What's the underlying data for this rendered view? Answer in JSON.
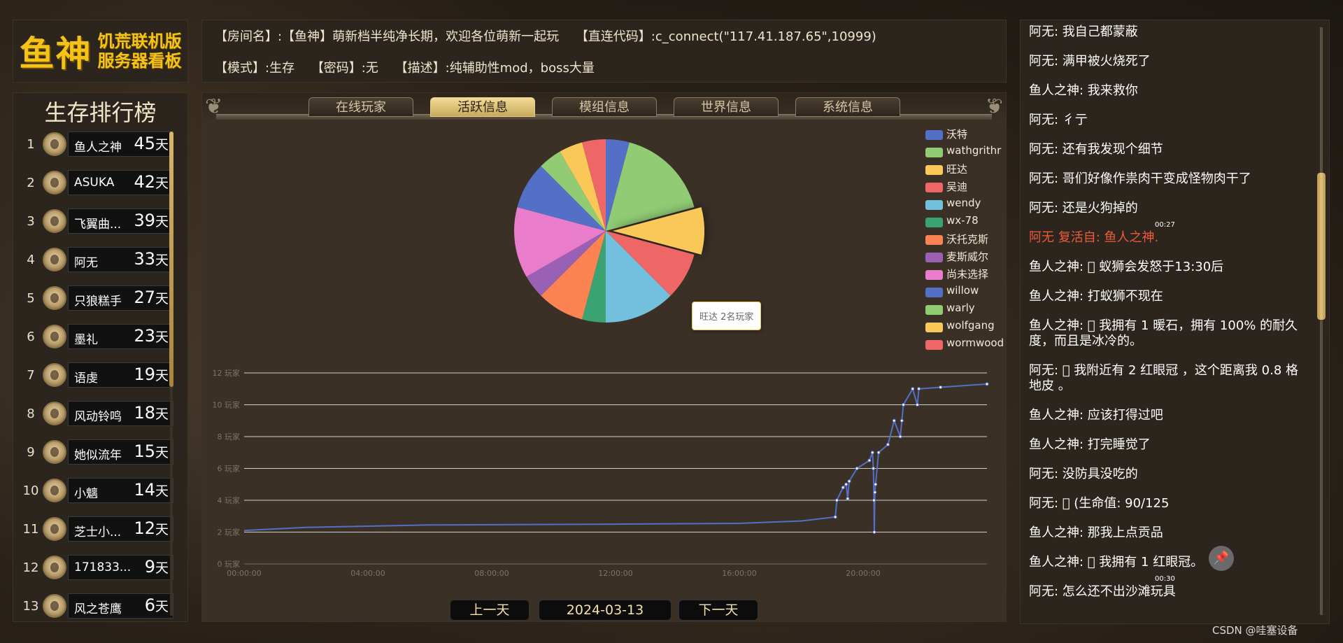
{
  "logo": {
    "big": "鱼神",
    "line1": "饥荒联机版",
    "line2": "服务器看板"
  },
  "ranking": {
    "title": "生存排行榜",
    "day_unit": "天",
    "items": [
      {
        "rank": "1",
        "name": "鱼人之神",
        "days": "45"
      },
      {
        "rank": "2",
        "name": "ASUKA",
        "days": "42"
      },
      {
        "rank": "3",
        "name": "飞翼曲...",
        "days": "39"
      },
      {
        "rank": "4",
        "name": "阿无",
        "days": "33"
      },
      {
        "rank": "5",
        "name": "只狼糕手",
        "days": "27"
      },
      {
        "rank": "6",
        "name": "墨礼",
        "days": "23"
      },
      {
        "rank": "7",
        "name": "语虔",
        "days": "19"
      },
      {
        "rank": "8",
        "name": "风动铃鸣",
        "days": "18"
      },
      {
        "rank": "9",
        "name": "她似流年",
        "days": "15"
      },
      {
        "rank": "10",
        "name": "小魑",
        "days": "14"
      },
      {
        "rank": "11",
        "name": "芝士小...",
        "days": "12"
      },
      {
        "rank": "12",
        "name": "171833...",
        "days": "9"
      },
      {
        "rank": "13",
        "name": "风之苍鹰",
        "days": "6"
      }
    ]
  },
  "info": {
    "room_label": "【房间名】:",
    "room_value": "【鱼神】萌新档半纯净长期，欢迎各位萌新一起玩",
    "connect_label": "【直连代码】:",
    "connect_value": "c_connect(\"117.41.187.65\",10999)",
    "mode_label": "【模式】:",
    "mode_value": "生存",
    "password_label": "【密码】:",
    "password_value": "无",
    "desc_label": "【描述】:",
    "desc_value": "纯辅助性mod，boss大量"
  },
  "tabs": [
    {
      "label": "在线玩家",
      "active": false
    },
    {
      "label": "活跃信息",
      "active": true
    },
    {
      "label": "模组信息",
      "active": false
    },
    {
      "label": "世界信息",
      "active": false
    },
    {
      "label": "系统信息",
      "active": false
    }
  ],
  "tooltip": "旺达 2名玩家",
  "date_nav": {
    "prev": "上一天",
    "date": "2024-03-13",
    "next": "下一天"
  },
  "chart_data": [
    {
      "type": "pie",
      "legend_position": "right",
      "categories": [
        "沃特",
        "wathgrithr",
        "旺达",
        "吴迪",
        "wendy",
        "wx-78",
        "沃托克斯",
        "麦斯威尔",
        "尚未选择",
        "willow",
        "warly",
        "wolfgang",
        "wormwood"
      ],
      "values": [
        1,
        4,
        2,
        2,
        3,
        1,
        2,
        1,
        3,
        2,
        1,
        1,
        1
      ],
      "colors": [
        "#5470c6",
        "#91cc75",
        "#fac858",
        "#ee6666",
        "#73c0de",
        "#3ba272",
        "#fc8452",
        "#9a60b4",
        "#ea7ccc",
        "#5470c6",
        "#91cc75",
        "#fac858",
        "#ee6666"
      ]
    },
    {
      "type": "line",
      "y_unit": "玩家",
      "ylim": [
        0,
        12
      ],
      "y_ticks": [
        "0 玩家",
        "2 玩家",
        "4 玩家",
        "6 玩家",
        "8 玩家",
        "10 玩家",
        "12 玩家"
      ],
      "x_ticks": [
        "00:00:00",
        "04:00:00",
        "08:00:00",
        "12:00:00",
        "16:00:00",
        "20:00:00"
      ],
      "x_range_hours": [
        0,
        24
      ],
      "color": "#5470c6",
      "points": [
        [
          0,
          2.1
        ],
        [
          2,
          2.3
        ],
        [
          6,
          2.45
        ],
        [
          12,
          2.5
        ],
        [
          16,
          2.55
        ],
        [
          18,
          2.7
        ],
        [
          19.1,
          2.95
        ],
        [
          19.15,
          4.0
        ],
        [
          19.35,
          4.8
        ],
        [
          19.45,
          5.0
        ],
        [
          19.5,
          4.1
        ],
        [
          19.55,
          5.2
        ],
        [
          19.8,
          6.0
        ],
        [
          20.2,
          6.5
        ],
        [
          20.3,
          7.0
        ],
        [
          20.33,
          6.0
        ],
        [
          20.35,
          4.0
        ],
        [
          20.36,
          2.0
        ],
        [
          20.38,
          4.5
        ],
        [
          20.4,
          5.0
        ],
        [
          20.5,
          7.0
        ],
        [
          20.8,
          7.5
        ],
        [
          21.0,
          9.0
        ],
        [
          21.2,
          8.0
        ],
        [
          21.25,
          9.0
        ],
        [
          21.3,
          10.0
        ],
        [
          21.6,
          11.0
        ],
        [
          21.75,
          10.0
        ],
        [
          21.8,
          11.0
        ],
        [
          22.5,
          11.1
        ],
        [
          24,
          11.3
        ]
      ]
    }
  ],
  "chat": [
    {
      "text": "阿无: 我自己都蒙蔽"
    },
    {
      "text": "阿无: 满甲被火烧死了"
    },
    {
      "text": "鱼人之神: 我来救你"
    },
    {
      "text": "阿无: 彳亍"
    },
    {
      "text": "阿无: 还有我发现个细节"
    },
    {
      "text": "阿无: 哥们好像作祟肉干变成怪物肉干了"
    },
    {
      "text": "阿无: 还是火狗掉的"
    },
    {
      "text": "阿无 复活自:   鱼人之神.",
      "system": true,
      "time": "00:27"
    },
    {
      "text": "鱼人之神: 󰀀 蚁狮会发怒于13:30后"
    },
    {
      "text": "鱼人之神: 打蚁狮不现在"
    },
    {
      "text": "鱼人之神: 󰀀 我拥有 1 暖石，拥有 100% 的耐久度，而且是冰冷的。"
    },
    {
      "text": "阿无: 󰀀 我附近有 2 红眼冠 ，这个距离我 0.8 格地皮 。"
    },
    {
      "text": "鱼人之神: 应该打得过吧"
    },
    {
      "text": "鱼人之神: 打完睡觉了"
    },
    {
      "text": "阿无: 没防具没吃的"
    },
    {
      "text": "阿无: 󰀀 (生命值: 90/125"
    },
    {
      "text": "鱼人之神: 那我上点贡品"
    },
    {
      "text": "鱼人之神: 󰀀 我拥有 1 红眼冠。"
    },
    {
      "text": "阿无: 怎么还不出沙滩玩具",
      "time": "00:30"
    }
  ],
  "pin_icon": "pin-icon",
  "watermark": "CSDN @哇塞设备"
}
